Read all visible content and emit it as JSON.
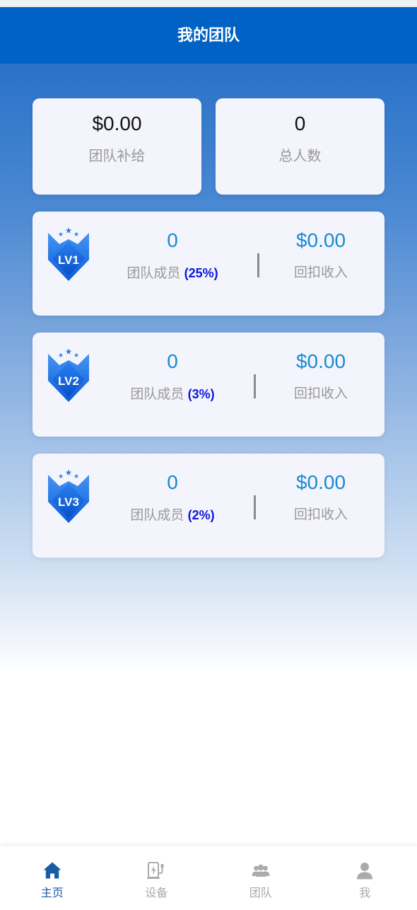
{
  "header": {
    "title": "我的团队"
  },
  "summary": [
    {
      "value": "$0.00",
      "label": "团队补给"
    },
    {
      "value": "0",
      "label": "总人数"
    }
  ],
  "levels": [
    {
      "badge": "LV1",
      "members": "0",
      "members_label": "团队成员",
      "rate": "(25%)",
      "income": "$0.00",
      "income_label": "回扣收入"
    },
    {
      "badge": "LV2",
      "members": "0",
      "members_label": "团队成员",
      "rate": "(3%)",
      "income": "$0.00",
      "income_label": "回扣收入"
    },
    {
      "badge": "LV3",
      "members": "0",
      "members_label": "团队成员",
      "rate": "(2%)",
      "income": "$0.00",
      "income_label": "回扣收入"
    }
  ],
  "nav": [
    {
      "label": "主页",
      "icon": "home-icon",
      "active": true
    },
    {
      "label": "设备",
      "icon": "charger-icon",
      "active": false
    },
    {
      "label": "团队",
      "icon": "team-icon",
      "active": false
    },
    {
      "label": "我",
      "icon": "user-icon",
      "active": false
    }
  ],
  "colors": {
    "header": "#0062c4",
    "accent": "#1a8ad0",
    "rate": "#0d18d8",
    "nav_active": "#1a5ba6",
    "nav_inactive": "#ababab"
  }
}
